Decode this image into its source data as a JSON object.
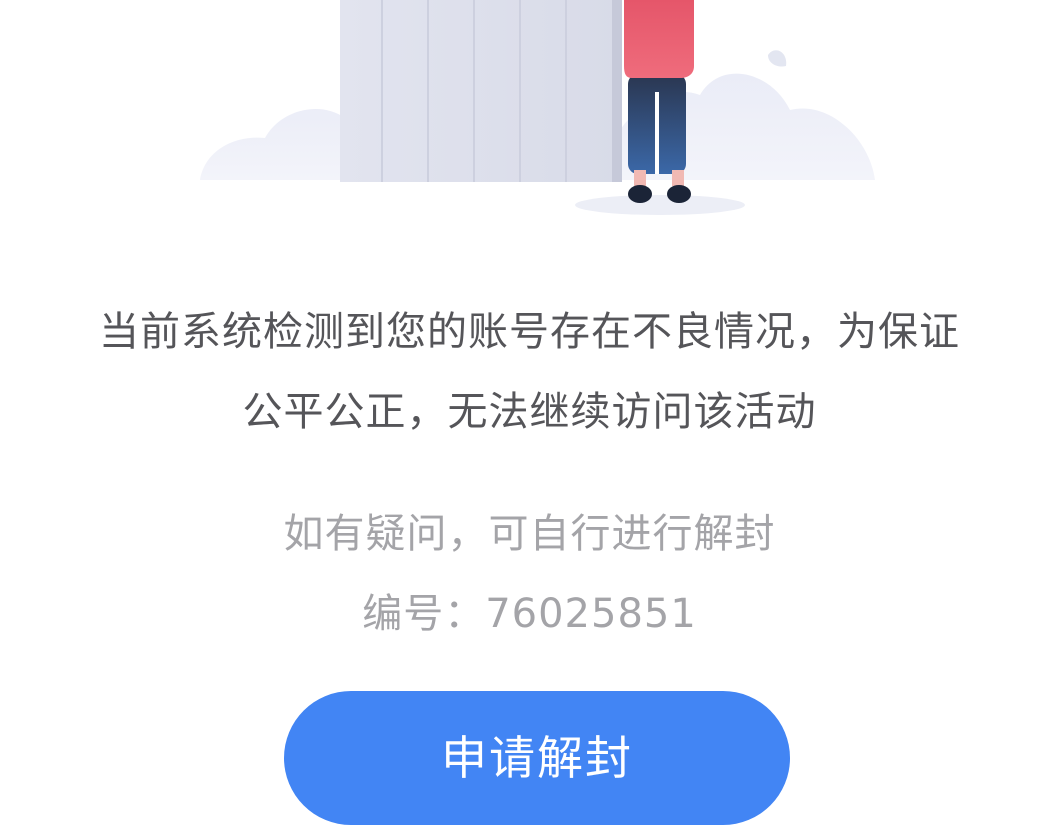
{
  "notice": {
    "line1": "当前系统检测到您的账号存在不良情况，为保证",
    "line2": "公平公正，无法继续访问该活动"
  },
  "hint": {
    "text": "如有疑问，可自行进行解封",
    "id_label": "编号：",
    "id_value": "76025851"
  },
  "action": {
    "button_label": "申请解封"
  },
  "colors": {
    "button": "#4285f4",
    "primary_text": "#555559",
    "secondary_text": "#a4a4a8",
    "figure_shirt": "#e5566a",
    "figure_pants": "#2f4c82"
  }
}
